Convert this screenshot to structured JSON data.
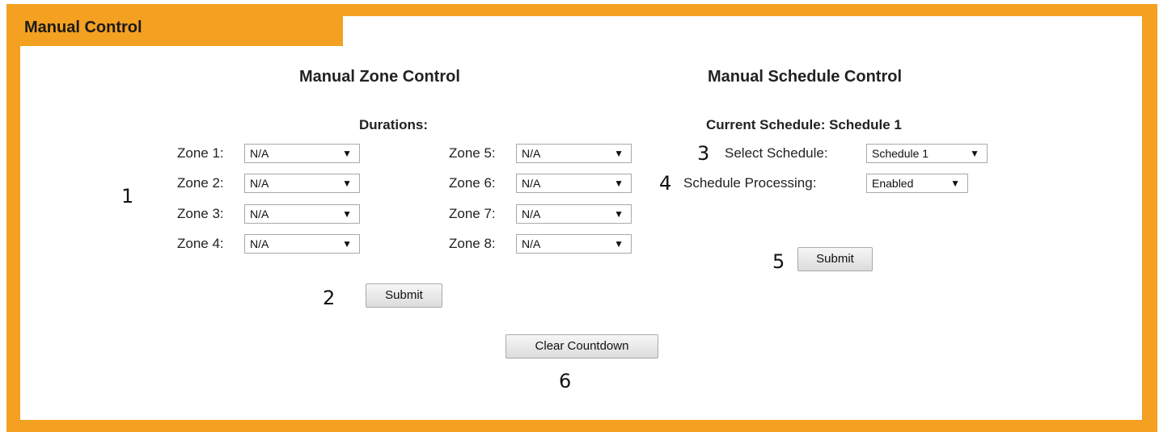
{
  "panel": {
    "title": "Manual Control"
  },
  "zone_control": {
    "title": "Manual Zone Control",
    "durations_label": "Durations:",
    "zones": [
      {
        "label": "Zone 1:",
        "value": "N/A"
      },
      {
        "label": "Zone 2:",
        "value": "N/A"
      },
      {
        "label": "Zone 3:",
        "value": "N/A"
      },
      {
        "label": "Zone 4:",
        "value": "N/A"
      },
      {
        "label": "Zone 5:",
        "value": "N/A"
      },
      {
        "label": "Zone 6:",
        "value": "N/A"
      },
      {
        "label": "Zone 7:",
        "value": "N/A"
      },
      {
        "label": "Zone 8:",
        "value": "N/A"
      }
    ],
    "submit_label": "Submit"
  },
  "schedule_control": {
    "title": "Manual Schedule Control",
    "current_schedule": "Current Schedule: Schedule 1",
    "select_label": "Select Schedule:",
    "select_value": "Schedule 1",
    "processing_label": "Schedule Processing:",
    "processing_value": "Enabled",
    "submit_label": "Submit"
  },
  "clear_countdown_label": "Clear Countdown",
  "annotations": {
    "n1": "1",
    "n2": "2",
    "n3": "3",
    "n4": "4",
    "n5": "5",
    "n6": "6"
  },
  "colors": {
    "frame": "#F4A021"
  },
  "icons": {
    "dropdown_arrow": "▼"
  }
}
